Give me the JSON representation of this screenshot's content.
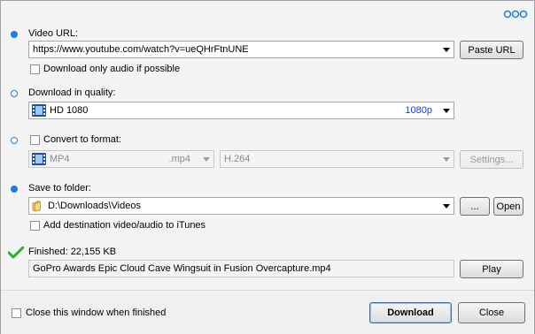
{
  "menu": {
    "dots_icon": "more-options-icon"
  },
  "video_url": {
    "label": "Video URL:",
    "value": "https://www.youtube.com/watch?v=ueQHrFtnUNE",
    "paste_button": "Paste URL",
    "audio_only_label": "Download only audio if possible",
    "audio_only_checked": false
  },
  "quality": {
    "label": "Download in quality:",
    "value": "HD 1080",
    "resolution": "1080p"
  },
  "convert": {
    "label": "Convert to format:",
    "checked": false,
    "format_name": "MP4",
    "format_ext": ".mp4",
    "codec": "H.264",
    "settings_button": "Settings..."
  },
  "save": {
    "label": "Save to folder:",
    "path": "D:\\Downloads\\Videos",
    "browse_button": "...",
    "open_button": "Open",
    "itunes_label": "Add destination video/audio to iTunes",
    "itunes_checked": false
  },
  "finished": {
    "label": "Finished: 22,155 KB",
    "filename": "GoPro Awards  Epic Cloud Cave Wingsuit in Fusion Overcapture.mp4",
    "play_button": "Play"
  },
  "footer": {
    "close_when_finished_label": "Close this window when finished",
    "close_when_finished_checked": false,
    "download_button": "Download",
    "close_button": "Close"
  },
  "colors": {
    "accent": "#1b7fe0",
    "resolution_text": "#1a3fd6",
    "check_green": "#2bb02b"
  }
}
